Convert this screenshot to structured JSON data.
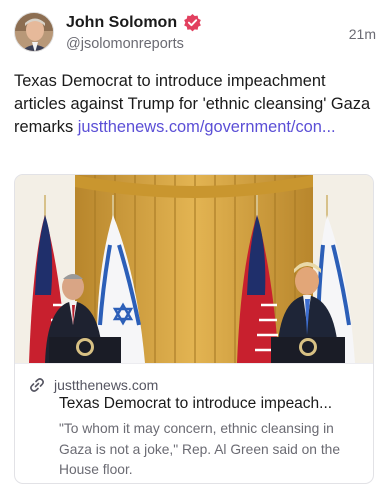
{
  "post": {
    "author_name": "John Solomon",
    "author_handle": "@jsolomonreports",
    "timestamp": "21m",
    "verified_icon": "verified-badge-icon",
    "text": "Texas Democrat to introduce impeachment articles against Trump for 'ethnic cleansing' Gaza remarks ",
    "link_text": "justthenews.com/government/con..."
  },
  "link_card": {
    "domain": "justthenews.com",
    "title": "Texas Democrat to introduce impeach...",
    "description": "\"To whom it may concern, ethnic cleansing in Gaza is not a joke,\" Rep. Al Green said on the House floor."
  },
  "colors": {
    "accent": "#5b4fd6",
    "verified": "#e2405f",
    "secondary_text": "#6b6b73"
  }
}
